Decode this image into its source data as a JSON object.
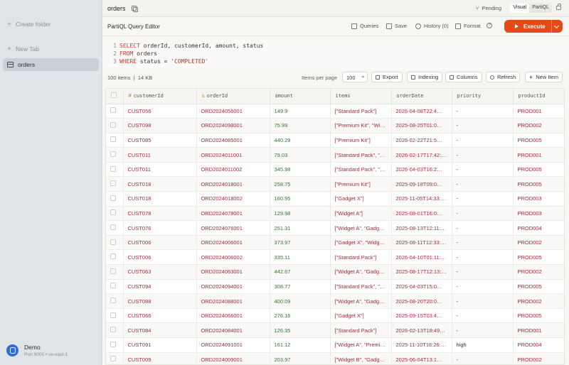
{
  "sidebar": {
    "create_folder": "Create folder",
    "new_tab": "New Tab",
    "items": [
      {
        "label": "orders"
      }
    ],
    "connection": {
      "name": "Demo",
      "detail": "Port 9000 • us-east-1"
    }
  },
  "topbar": {
    "title": "orders",
    "pending": "Pending",
    "modes": [
      "Visual",
      "PartiQL"
    ]
  },
  "editor": {
    "title": "PartiQL Query Editor",
    "queries": "Queries",
    "save": "Save",
    "history": "History (0)",
    "format": "Format",
    "help": "?",
    "execute": "Execute",
    "lines": [
      {
        "n": "1",
        "kw": "SELECT",
        "rest": " orderId, customerId, amount, status",
        "str": ""
      },
      {
        "n": "2",
        "kw": "FROM",
        "rest": " orders",
        "str": ""
      },
      {
        "n": "3",
        "kw": "WHERE",
        "rest": " status = ",
        "str": "'COMPLETED'"
      }
    ]
  },
  "toolbar": {
    "count": "100 items",
    "size": "14 KB",
    "per_page_label": "Items per page",
    "per_page_value": "100",
    "export": "Export",
    "indexing": "Indexing",
    "columns": "Columns",
    "refresh": "Refresh",
    "new_item": "New Item"
  },
  "table": {
    "columns": [
      "customerId",
      "orderId",
      "amount",
      "items",
      "orderDate",
      "priority",
      "productId"
    ],
    "rows": [
      [
        "CUST056",
        "ORD2024056001",
        "149.9",
        "[\"Standard Pack\"]",
        "2026-04-08T22:4…",
        "-",
        "PROD001"
      ],
      [
        "CUST098",
        "ORD2024098001",
        "75.99",
        "[\"Premium Kit\", \"Wi…",
        "2025-08-25T01:0…",
        "-",
        "PROD002"
      ],
      [
        "CUST085",
        "ORD2024085001",
        "440.29",
        "[\"Premium Kit\"]",
        "2026-02-22T21:5…",
        "-",
        "PROD005"
      ],
      [
        "CUST011",
        "ORD2024011001",
        "79.03",
        "[\"Standard Pack\", \"…",
        "2026-02-17T17:42:…",
        "-",
        "PROD001"
      ],
      [
        "CUST011",
        "ORD2024011002",
        "345.98",
        "[\"Standard Pack\", \"…",
        "2026-04-03T16:2…",
        "-",
        "PROD005"
      ],
      [
        "CUST018",
        "ORD2024018001",
        "258.75",
        "[\"Premium Kit\"]",
        "2025-09-18T09:0…",
        "-",
        "PROD005"
      ],
      [
        "CUST018",
        "ORD2024018002",
        "160.95",
        "[\"Gadget X\"]",
        "2025-11-05T14:33:…",
        "-",
        "PROD003"
      ],
      [
        "CUST078",
        "ORD2024078001",
        "129.98",
        "[\"Widget A\"]",
        "2025-08-01T16:0…",
        "-",
        "PROD003"
      ],
      [
        "CUST076",
        "ORD2024076001",
        "251.31",
        "[\"Widget A\", \"Gadg…",
        "2025-08-13T12:11:…",
        "-",
        "PROD004"
      ],
      [
        "CUST006",
        "ORD2024006001",
        "373.97",
        "[\"Gadget X\", \"Widg…",
        "2025-08-11T12:33:…",
        "-",
        "PROD002"
      ],
      [
        "CUST006",
        "ORD2024006002",
        "335.11",
        "[\"Standard Pack\"]",
        "2026-04-10T01:11:…",
        "-",
        "PROD005"
      ],
      [
        "CUST063",
        "ORD2024063001",
        "442.67",
        "[\"Widget A\", \"Gadg…",
        "2025-08-17T12:13:…",
        "-",
        "PROD002"
      ],
      [
        "CUST094",
        "ORD2024094001",
        "308.77",
        "[\"Standard Pack\", \"…",
        "2026-04-03T15:0…",
        "-",
        "PROD005"
      ],
      [
        "CUST088",
        "ORD2024088001",
        "400.09",
        "[\"Widget A\", \"Gadg…",
        "2025-08-20T20:0…",
        "-",
        "PROD002"
      ],
      [
        "CUST066",
        "ORD2024066001",
        "276.16",
        "[\"Gadget X\"]",
        "2025-09-15T03:4…",
        "-",
        "PROD005"
      ],
      [
        "CUST084",
        "ORD2024084001",
        "126.35",
        "[\"Standard Pack\"]",
        "2026-02-13T18:49…",
        "-",
        "PROD001"
      ],
      [
        "CUST091",
        "ORD2024091001",
        "161.12",
        "[\"Widget A\", \"Premi…",
        "2025-11-10T16:26:…",
        "high",
        "PROD004"
      ],
      [
        "CUST009",
        "ORD2024009001",
        "203.97",
        "[\"Widget B\", \"Gadg…",
        "2025-06-04T13:1…",
        "-",
        "PROD002"
      ]
    ]
  },
  "colors": {
    "accent": "#e34a18",
    "sidebar": "#dfe4e8",
    "link_red": "#a7283a",
    "number_green": "#2d7a2d"
  }
}
